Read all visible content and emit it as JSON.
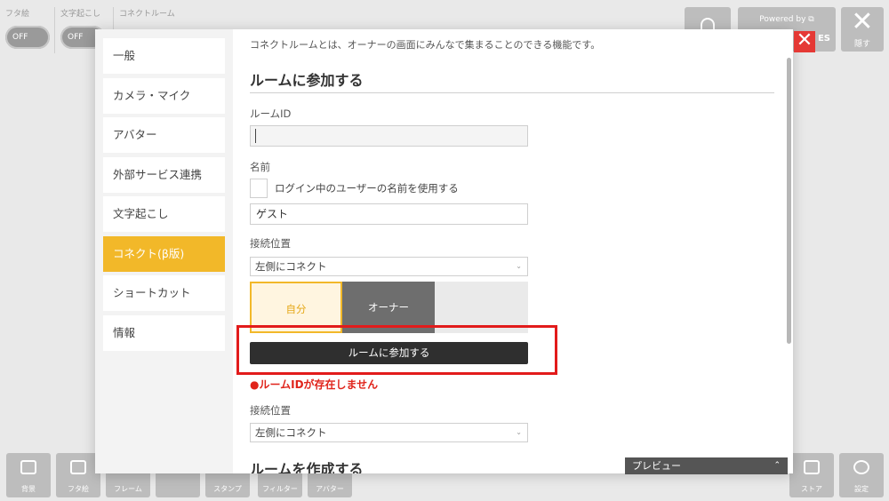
{
  "top_toggles": [
    {
      "label": "フタ絵",
      "state": "OFF"
    },
    {
      "label": "文字起こし",
      "state": "OFF"
    }
  ],
  "top_room_label": "コネクトルーム",
  "top_right": {
    "powered_label": "Powered by",
    "powered_suffix": "ES",
    "hide_label": "隠す",
    "hide_glyph": "✕"
  },
  "sidebar": {
    "items": [
      {
        "label": "一般"
      },
      {
        "label": "カメラ・マイク"
      },
      {
        "label": "アバター"
      },
      {
        "label": "外部サービス連携"
      },
      {
        "label": "文字起こし"
      },
      {
        "label": "コネクト(β版)"
      },
      {
        "label": "ショートカット"
      },
      {
        "label": "情報"
      }
    ],
    "active_index": 5
  },
  "content": {
    "intro": "コネクトルームとは、オーナーの画面にみんなで集まることのできる機能です。",
    "join_section": {
      "title": "ルームに参加する",
      "room_id_label": "ルームID",
      "room_id_value": "",
      "name_label": "名前",
      "use_login_name_label": "ログイン中のユーザーの名前を使用する",
      "name_value": "ゲスト",
      "position_label": "接続位置",
      "position_value": "左側にコネクト",
      "position_options": [
        "自分",
        "オーナー"
      ],
      "join_button": "ルームに参加する",
      "error": "●ルームIDが存在しません",
      "position_label_2": "接続位置",
      "position_value_2": "左側にコネクト"
    },
    "create_section": {
      "title": "ルームを作成する"
    }
  },
  "preview": {
    "label": "プレビュー"
  },
  "close_glyph": "✕",
  "bottom_bar": [
    {
      "label": "背景"
    },
    {
      "label": "フタ絵"
    },
    {
      "label": "フレーム"
    },
    {
      "label": ""
    },
    {
      "label": "スタンプ"
    },
    {
      "label": "フィルター"
    },
    {
      "label": "アバター"
    },
    {
      "label": "ストア"
    },
    {
      "label": "設定"
    }
  ],
  "colors": {
    "accent": "#f2b829",
    "error": "#e0241b",
    "highlight": "#e21b1b",
    "button_dark": "#2f2f2f"
  }
}
